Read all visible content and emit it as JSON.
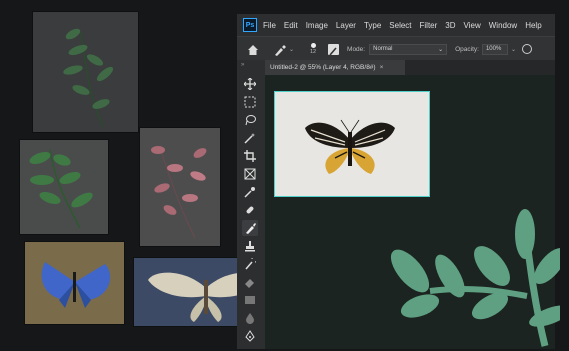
{
  "menubar": {
    "logo": "Ps",
    "items": [
      "File",
      "Edit",
      "Image",
      "Layer",
      "Type",
      "Select",
      "Filter",
      "3D",
      "View",
      "Window",
      "Help"
    ]
  },
  "options": {
    "brush_size": "12",
    "mode_label": "Mode:",
    "mode_value": "Normal",
    "opacity_label": "Opacity:",
    "opacity_value": "100%"
  },
  "document": {
    "tab_title": "Untitled-2 @ 55% (Layer 4, RGB/8#)",
    "close": "×"
  },
  "colors": {
    "accent": "#31a8ff",
    "canvas_bg": "#1b2420",
    "leaf_green": "#5fa083",
    "selection": "#4fd0c8"
  }
}
